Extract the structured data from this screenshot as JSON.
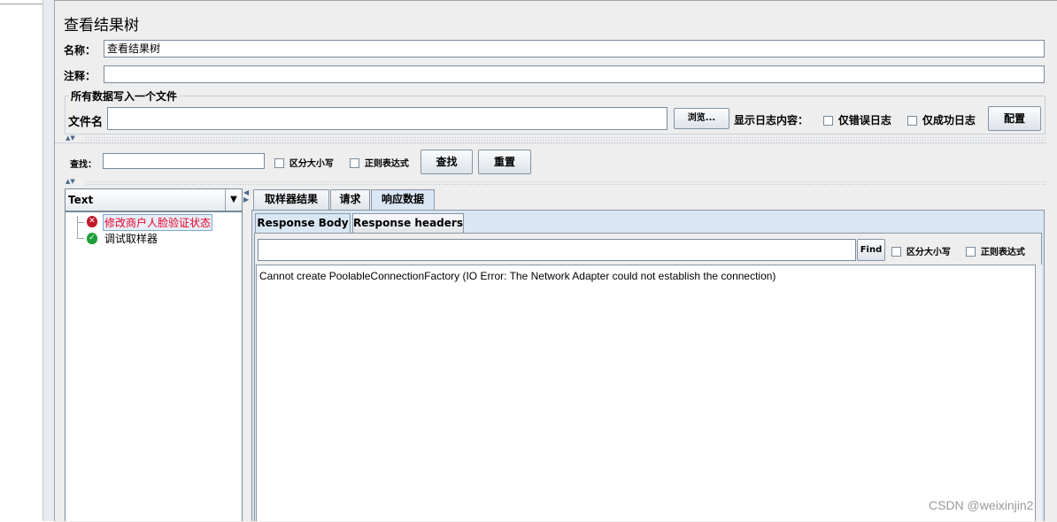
{
  "panel": {
    "title": "查看结果树"
  },
  "fields": {
    "name_label": "名称：",
    "name_value": "查看结果树",
    "comment_label": "注释：",
    "comment_value": ""
  },
  "file_group": {
    "title": "所有数据写入一个文件",
    "filename_label": "文件名",
    "filename_value": "",
    "browse_label": "浏览...",
    "log_label": "显示日志内容：",
    "errors_only_label": "仅错误日志",
    "success_only_label": "仅成功日志",
    "config_label": "配置"
  },
  "search": {
    "label": "查找：",
    "value": "",
    "case_label": "区分大小写",
    "regex_label": "正则表达式",
    "find_label": "查找",
    "reset_label": "重置"
  },
  "renderer": {
    "selected": "Text"
  },
  "tree": [
    {
      "label": "修改商户人脸验证状态",
      "status": "error"
    },
    {
      "label": "调试取样器",
      "status": "success"
    }
  ],
  "result_tabs": [
    "取样器结果",
    "请求",
    "响应数据"
  ],
  "response_tabs": [
    "Response Body",
    "Response headers"
  ],
  "response_search": {
    "value": "",
    "find_label": "Find",
    "case_label": "区分大小写",
    "regex_label": "正则表达式"
  },
  "response_body": "Cannot create PoolableConnectionFactory (IO Error: The Network Adapter could not establish the connection)",
  "watermark": "CSDN @weixinjin2",
  "colors": {
    "selected_tab": "#d9e6f3",
    "error_text": "#e8002d",
    "error_icon": "#c0172b",
    "success_icon": "#1e9e3a"
  }
}
